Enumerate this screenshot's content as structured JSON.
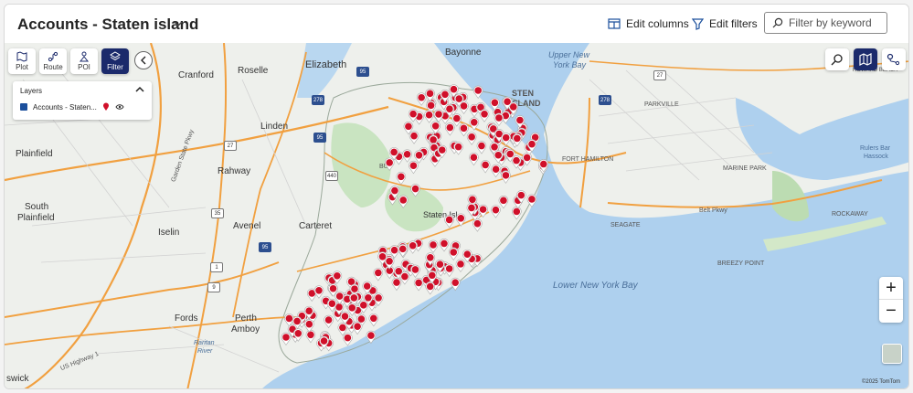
{
  "header": {
    "title": "Accounts - Staten island",
    "edit_columns": "Edit columns",
    "edit_filters": "Edit filters",
    "search_placeholder": "Filter by keyword"
  },
  "toolbar": {
    "plot": "Plot",
    "route": "Route",
    "poi": "POI",
    "filter": "Filter"
  },
  "layers": {
    "title": "Layers",
    "item": "Accounts - Staten..."
  },
  "map_labels": {
    "bayonne": "Bayonne",
    "upper_bay": "Upper New",
    "upper_bay2": "York Bay",
    "elizabeth": "Elizabeth",
    "cranford": "Cranford",
    "roselle": "Roselle",
    "linden": "Linden",
    "plainfield": "Plainfield",
    "rahway": "Rahway",
    "south": "South",
    "plainfield2": "Plainfield",
    "iselin": "Iselin",
    "avenel": "Avenel",
    "carteret": "Carteret",
    "fords": "Fords",
    "perth": "Perth",
    "amboy": "Amboy",
    "swick": "swick",
    "raritan": "Raritan",
    "river": "River",
    "us1": "US Highway 1",
    "gsp": "Garden State Pkwy",
    "staten_i": "Staten Isl",
    "staten_top1": "STEN",
    "staten_top2": "ISLAND",
    "bul": "BUL",
    "fort_hamilton": "FORT HAMILTON",
    "parkville": "PARKVILLE",
    "marine_park": "MARINE PARK",
    "seagate": "SEAGATE",
    "belt_pkwy": "Belt Pkwy",
    "rockaway": "ROCKAWAY",
    "breezy_point": "BREEZY POINT",
    "lower_bay": "Lower New York Bay",
    "rulers_bar": "Rulers Bar",
    "hassock": "Hassock",
    "howard_beach": "HOWARD BEACH",
    "r95a": "95",
    "r278a": "278",
    "r95b": "95",
    "r27": "27",
    "r35": "35",
    "r1": "1",
    "r440": "440",
    "r278b": "278",
    "r27b": "27",
    "r95c": "95",
    "r9": "9"
  },
  "attribution": "©2025 TomTom",
  "accent_color": "#1b2a6b",
  "marker_color": "#d0102a"
}
